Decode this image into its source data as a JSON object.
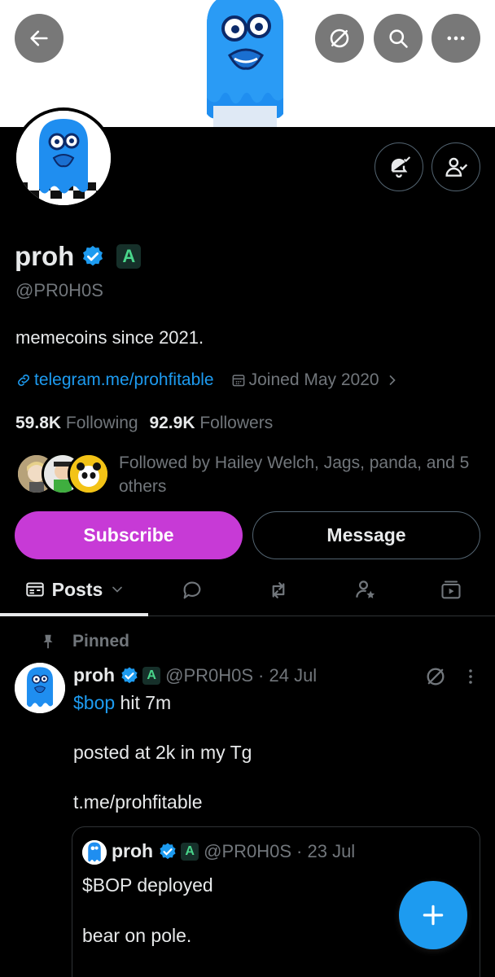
{
  "colors": {
    "accent": "#1d9bf0",
    "subscribe": "#c73ad6",
    "background": "#000000",
    "muted": "#71767b",
    "affiliate_badge": "#49d68b"
  },
  "header": {
    "icons": [
      "back-arrow-icon",
      "hide-icon",
      "search-icon",
      "more-icon"
    ]
  },
  "profile": {
    "name": "proh",
    "affiliate_badge": "A",
    "handle": "@PR0H0S",
    "bio": "memecoins since 2021.",
    "link": "telegram.me/prohfitable",
    "joined": "Joined May 2020",
    "following_count": "59.8K",
    "following_label": "Following",
    "followers_count": "92.9K",
    "followers_label": "Followers",
    "followed_by": "Followed by Hailey Welch, Jags, panda, and 5 others"
  },
  "actions": {
    "subscribe": "Subscribe",
    "message": "Message"
  },
  "tabs": {
    "posts": "Posts"
  },
  "post": {
    "pinned_label": "Pinned",
    "author": "proh",
    "badge": "A",
    "handle": "@PR0H0S",
    "date": "· 24 Jul",
    "cashtag": "$bop",
    "line1_rest": " hit 7m",
    "line2": "posted at 2k in my Tg",
    "link": "t.me/prohfitable"
  },
  "quote": {
    "author": "proh",
    "badge": "A",
    "handle": "@PR0H0S",
    "date": "· 23 Jul",
    "line1": "$BOP deployed",
    "line2": "bear on pole."
  }
}
